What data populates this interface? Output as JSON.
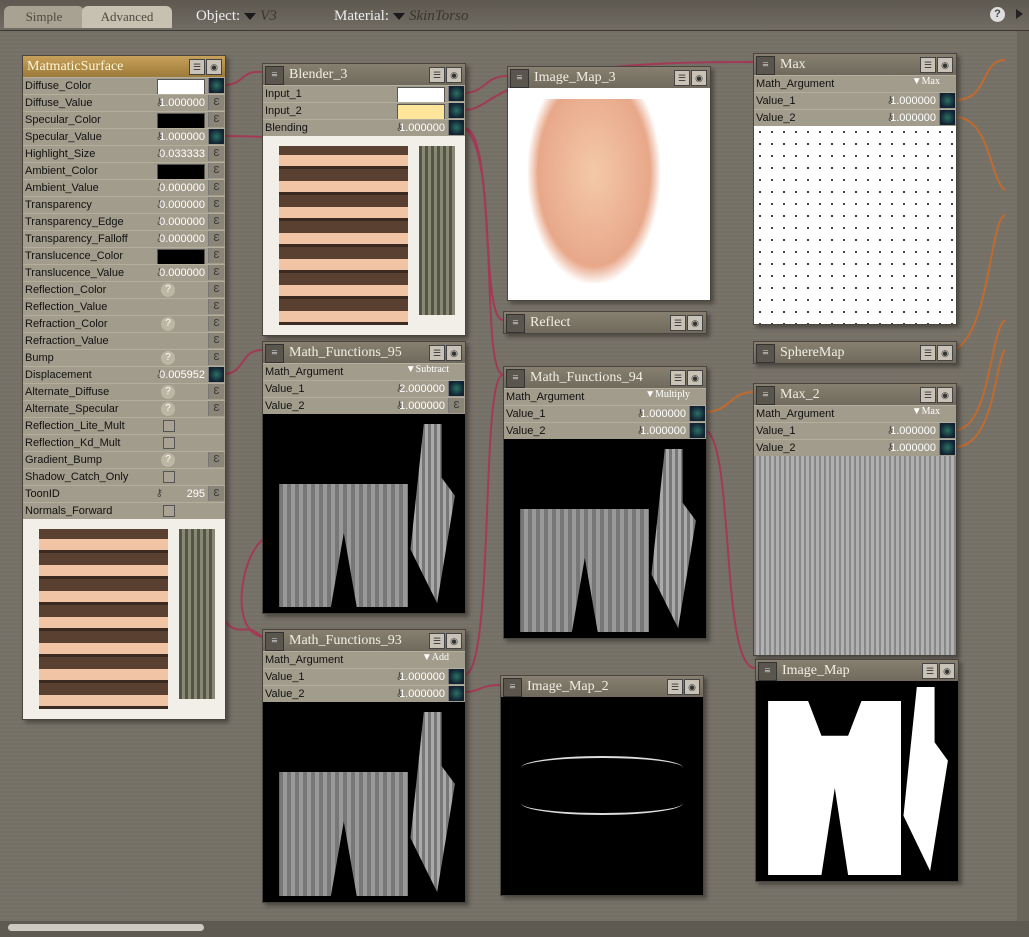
{
  "topbar": {
    "tabs": [
      "Simple",
      "Advanced"
    ],
    "object_label": "Object:",
    "object_value": "V3",
    "material_label": "Material:",
    "material_value": "SkinTorso",
    "help": "?"
  },
  "colors": {
    "wire": "#a33a55",
    "wire_orange": "#c06a30",
    "accent": "#b08a45"
  },
  "nodes": [
    {
      "id": "matmatic",
      "title": "MatmaticSurface",
      "root": true,
      "preview": "texture",
      "rows": [
        [
          "Diffuse_Color",
          "color",
          "#ffffff",
          true
        ],
        [
          "Diffuse_Value",
          "value",
          "1.000000",
          false
        ],
        [
          "Specular_Color",
          "color",
          "#000000",
          false
        ],
        [
          "Specular_Value",
          "value",
          "1.000000",
          true
        ],
        [
          "Highlight_Size",
          "value",
          "0.033333",
          false
        ],
        [
          "Ambient_Color",
          "color",
          "#000000",
          false
        ],
        [
          "Ambient_Value",
          "value",
          "0.000000",
          false
        ],
        [
          "Transparency",
          "value",
          "0.000000",
          false
        ],
        [
          "Transparency_Edge",
          "value",
          "0.000000",
          false
        ],
        [
          "Transparency_Falloff",
          "value",
          "0.000000",
          false
        ],
        [
          "Translucence_Color",
          "color",
          "#000000",
          false
        ],
        [
          "Translucence_Value",
          "value",
          "0.000000",
          false
        ],
        [
          "Reflection_Color",
          "question",
          "?",
          false
        ],
        [
          "Reflection_Value",
          "plain",
          "",
          false
        ],
        [
          "Refraction_Color",
          "question",
          "?",
          false
        ],
        [
          "Refraction_Value",
          "plain",
          "",
          false
        ],
        [
          "Bump",
          "question",
          "?",
          false
        ],
        [
          "Displacement",
          "value",
          "0.005952",
          true
        ],
        [
          "Alternate_Diffuse",
          "question",
          "?",
          false
        ],
        [
          "Alternate_Specular",
          "question",
          "?",
          false
        ],
        [
          "Reflection_Lite_Mult",
          "check",
          "",
          null
        ],
        [
          "Reflection_Kd_Mult",
          "check",
          "",
          null
        ],
        [
          "Gradient_Bump",
          "question",
          "?",
          false
        ],
        [
          "Shadow_Catch_Only",
          "check",
          "",
          null
        ],
        [
          "ToonID",
          "value",
          "295",
          false
        ],
        [
          "Normals_Forward",
          "check",
          "",
          null
        ]
      ]
    },
    {
      "id": "blender3",
      "title": "Blender_3",
      "preview": "texture",
      "rows": [
        [
          "Input_1",
          "color",
          "#ffffff",
          true
        ],
        [
          "Input_2",
          "color",
          "#ffe59a",
          true
        ],
        [
          "Blending",
          "value",
          "1.000000",
          true
        ]
      ]
    },
    {
      "id": "imagemap3",
      "title": "Image_Map_3",
      "preview": "skin",
      "rows": []
    },
    {
      "id": "reflect",
      "title": "Reflect",
      "rows": []
    },
    {
      "id": "max",
      "title": "Max",
      "preview": "dots",
      "rows": [
        [
          "Math_Argument",
          "dropdown",
          "Max",
          null
        ],
        [
          "Value_1",
          "value",
          "1.000000",
          true
        ],
        [
          "Value_2",
          "value",
          "1.000000",
          true
        ]
      ]
    },
    {
      "id": "spheremap",
      "title": "SphereMap",
      "rows": []
    },
    {
      "id": "max2",
      "title": "Max_2",
      "preview": "stripes",
      "rows": [
        [
          "Math_Argument",
          "dropdown",
          "Max",
          null
        ],
        [
          "Value_1",
          "value",
          "1.000000",
          true
        ],
        [
          "Value_2",
          "value",
          "1.000000",
          true
        ]
      ]
    },
    {
      "id": "imagemap",
      "title": "Image_Map",
      "preview": "white",
      "rows": []
    },
    {
      "id": "mf95",
      "title": "Math_Functions_95",
      "preview": "darkmask",
      "rows": [
        [
          "Math_Argument",
          "dropdown",
          "Subtract",
          null
        ],
        [
          "Value_1",
          "value",
          "2.000000",
          true
        ],
        [
          "Value_2",
          "value",
          "1.000000",
          false
        ]
      ]
    },
    {
      "id": "mf94",
      "title": "Math_Functions_94",
      "preview": "darkmask",
      "rows": [
        [
          "Math_Argument",
          "dropdown",
          "Multiply",
          null
        ],
        [
          "Value_1",
          "value",
          "1.000000",
          true
        ],
        [
          "Value_2",
          "value",
          "1.000000",
          true
        ]
      ]
    },
    {
      "id": "mf93",
      "title": "Math_Functions_93",
      "preview": "darkmask",
      "rows": [
        [
          "Math_Argument",
          "dropdown",
          "Add",
          null
        ],
        [
          "Value_1",
          "value",
          "1.000000",
          true
        ],
        [
          "Value_2",
          "value",
          "1.000000",
          true
        ]
      ]
    },
    {
      "id": "imagemap2",
      "title": "Image_Map_2",
      "preview": "lines",
      "rows": []
    }
  ]
}
